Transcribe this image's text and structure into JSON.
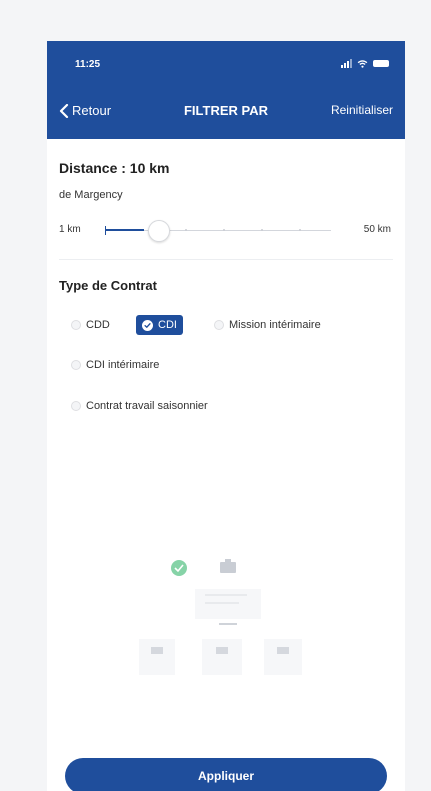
{
  "status_bar": {
    "time": "11:25"
  },
  "nav": {
    "back_label": "Retour",
    "title": "FILTRER PAR",
    "reset_label": "Reinitialiser"
  },
  "distance": {
    "title": "Distance : 10 km",
    "origin": "de Margency",
    "min_label": "1 km",
    "max_label": "50 km",
    "min_km": 1,
    "max_km": 50,
    "value_km": 10
  },
  "contract": {
    "title": "Type de Contrat",
    "options": [
      {
        "label": "CDD",
        "selected": false
      },
      {
        "label": "CDI",
        "selected": true
      },
      {
        "label": "Mission intérimaire",
        "selected": false
      },
      {
        "label": "CDI intérimaire",
        "selected": false
      },
      {
        "label": "Contrat travail saisonnier",
        "selected": false
      }
    ]
  },
  "apply_label": "Appliquer",
  "colors": {
    "primary": "#1f4e9c",
    "accent_check": "#5ec48a"
  }
}
